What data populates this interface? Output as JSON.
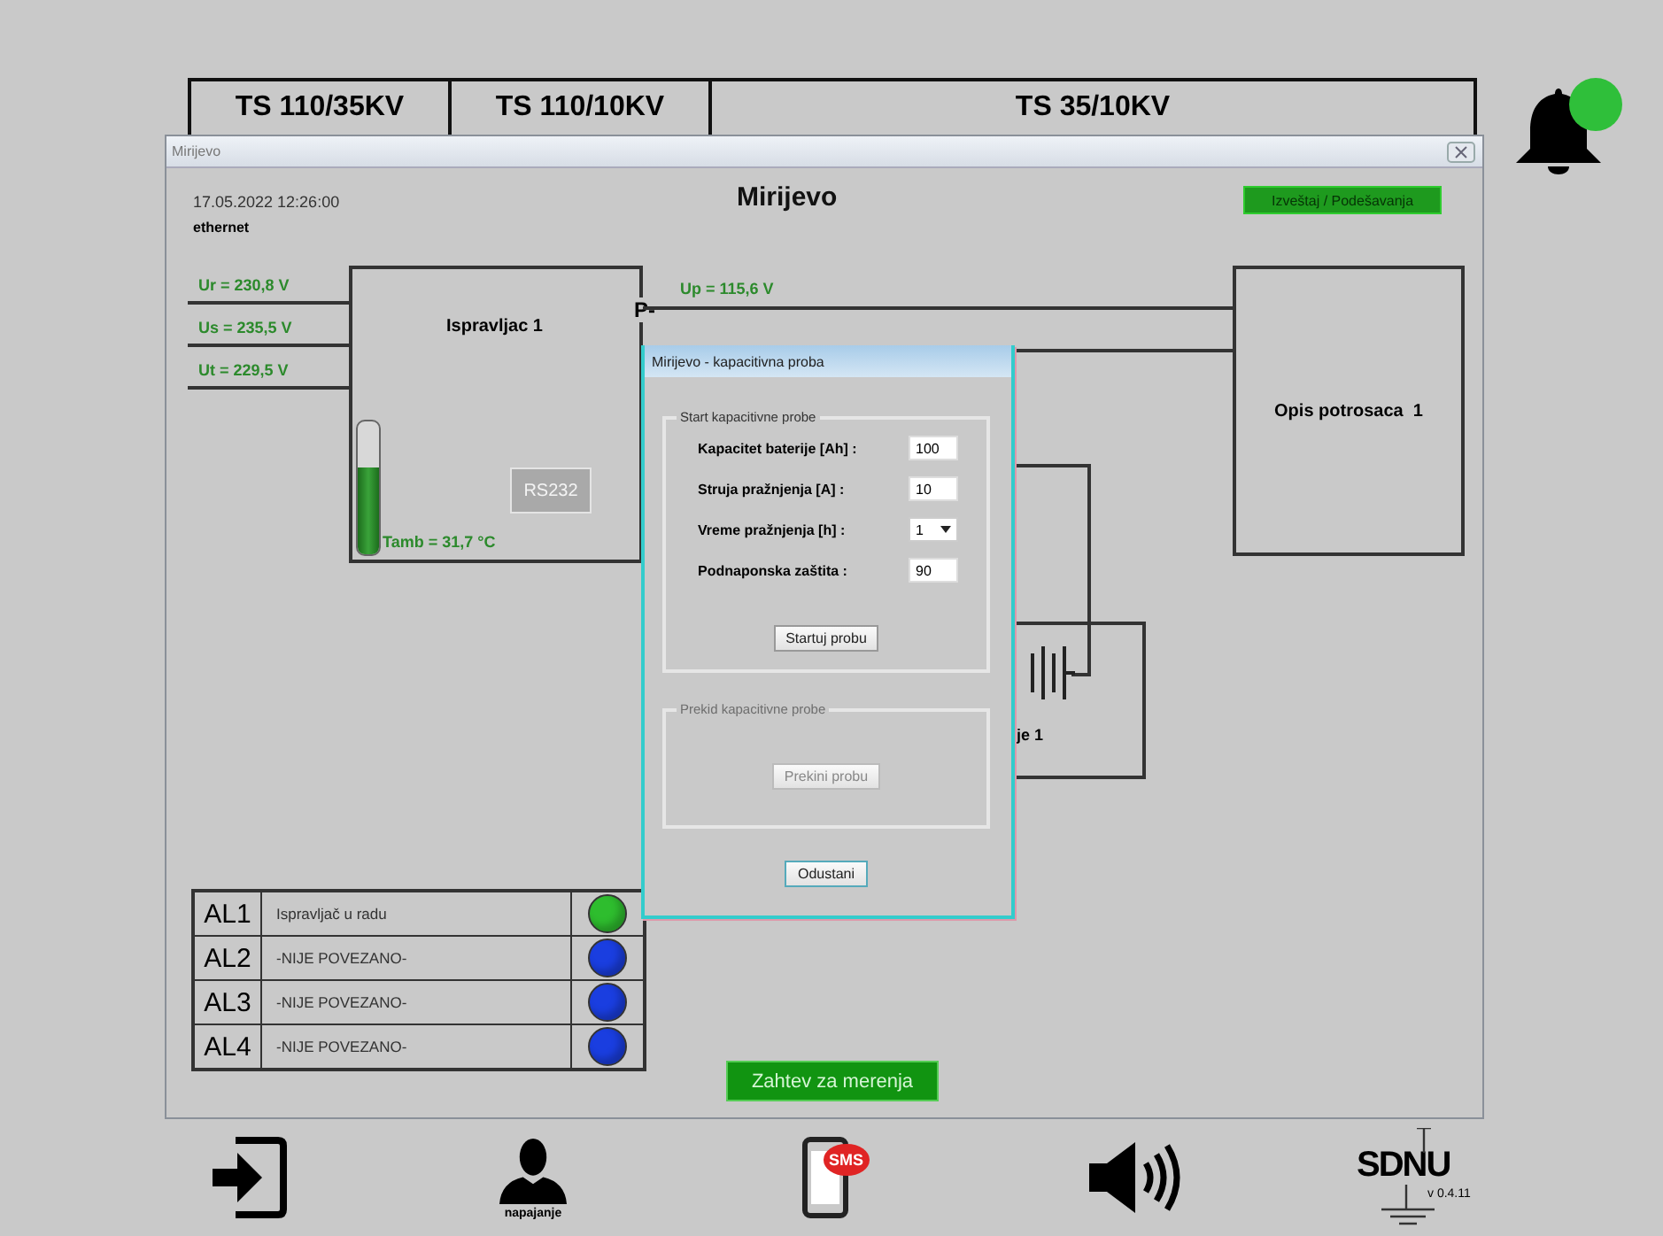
{
  "tabs": [
    {
      "label": "TS 110/35KV"
    },
    {
      "label": "TS 110/10KV"
    },
    {
      "label": "TS 35/10KV"
    }
  ],
  "notification": {
    "unread": true
  },
  "window": {
    "title": "Mirijevo",
    "datetime": "17.05.2022 12:26:00",
    "connection": "ethernet",
    "heading": "Mirijevo",
    "report_button": "Izveštaj / Podešavanja"
  },
  "diagram": {
    "inputs": [
      {
        "label": "Ur = 230,8 V"
      },
      {
        "label": "Us = 235,5 V"
      },
      {
        "label": "Ut = 229,5 V"
      }
    ],
    "rectifier": {
      "name": "Ispravljac 1",
      "terminal": "P-",
      "output": "Up = 115,6 V",
      "temperature": "Tamb = 31,7 °C"
    },
    "thermometer": {
      "level": 0.65
    },
    "port_button": {
      "label": "RS232",
      "disabled": true
    },
    "consumer": "Opis potrosaca  1",
    "battery_label": "je 1"
  },
  "alarms": [
    {
      "code": "AL1",
      "text": "Ispravljač u radu",
      "color": "#2ebd2e"
    },
    {
      "code": "AL2",
      "text": "-NIJE POVEZANO-",
      "color": "#1a3ee0"
    },
    {
      "code": "AL3",
      "text": "-NIJE POVEZANO-",
      "color": "#1a3ee0"
    },
    {
      "code": "AL4",
      "text": "-NIJE POVEZANO-",
      "color": "#1a3ee0"
    }
  ],
  "measure_button": "Zahtev za merenja",
  "dialog": {
    "title": "Mirijevo - kapacitivna proba",
    "start_group": {
      "title": "Start kapacitivne probe",
      "disabled": false,
      "fields": [
        {
          "label": "Kapacitet baterije [Ah] :",
          "value": "100",
          "kind": "text"
        },
        {
          "label": "Struja pražnjenja [A] :",
          "value": "10",
          "kind": "text"
        },
        {
          "label": "Vreme pražnjenja [h] :",
          "value": "1",
          "kind": "dropdown"
        },
        {
          "label": "Podnaponska zaštita :",
          "value": "90",
          "kind": "text"
        }
      ],
      "button": "Startuj probu"
    },
    "stop_group": {
      "title": "Prekid kapacitivne probe",
      "disabled": true,
      "button": "Prekini probu"
    },
    "cancel": "Odustani"
  },
  "bottom_bar": [
    {
      "kind": "exit"
    },
    {
      "kind": "user",
      "label": "napajanje"
    },
    {
      "kind": "sms",
      "badge": "SMS"
    },
    {
      "kind": "sound"
    },
    {
      "kind": "logo",
      "title": "SDNU",
      "version": "v 0.4.11"
    }
  ]
}
